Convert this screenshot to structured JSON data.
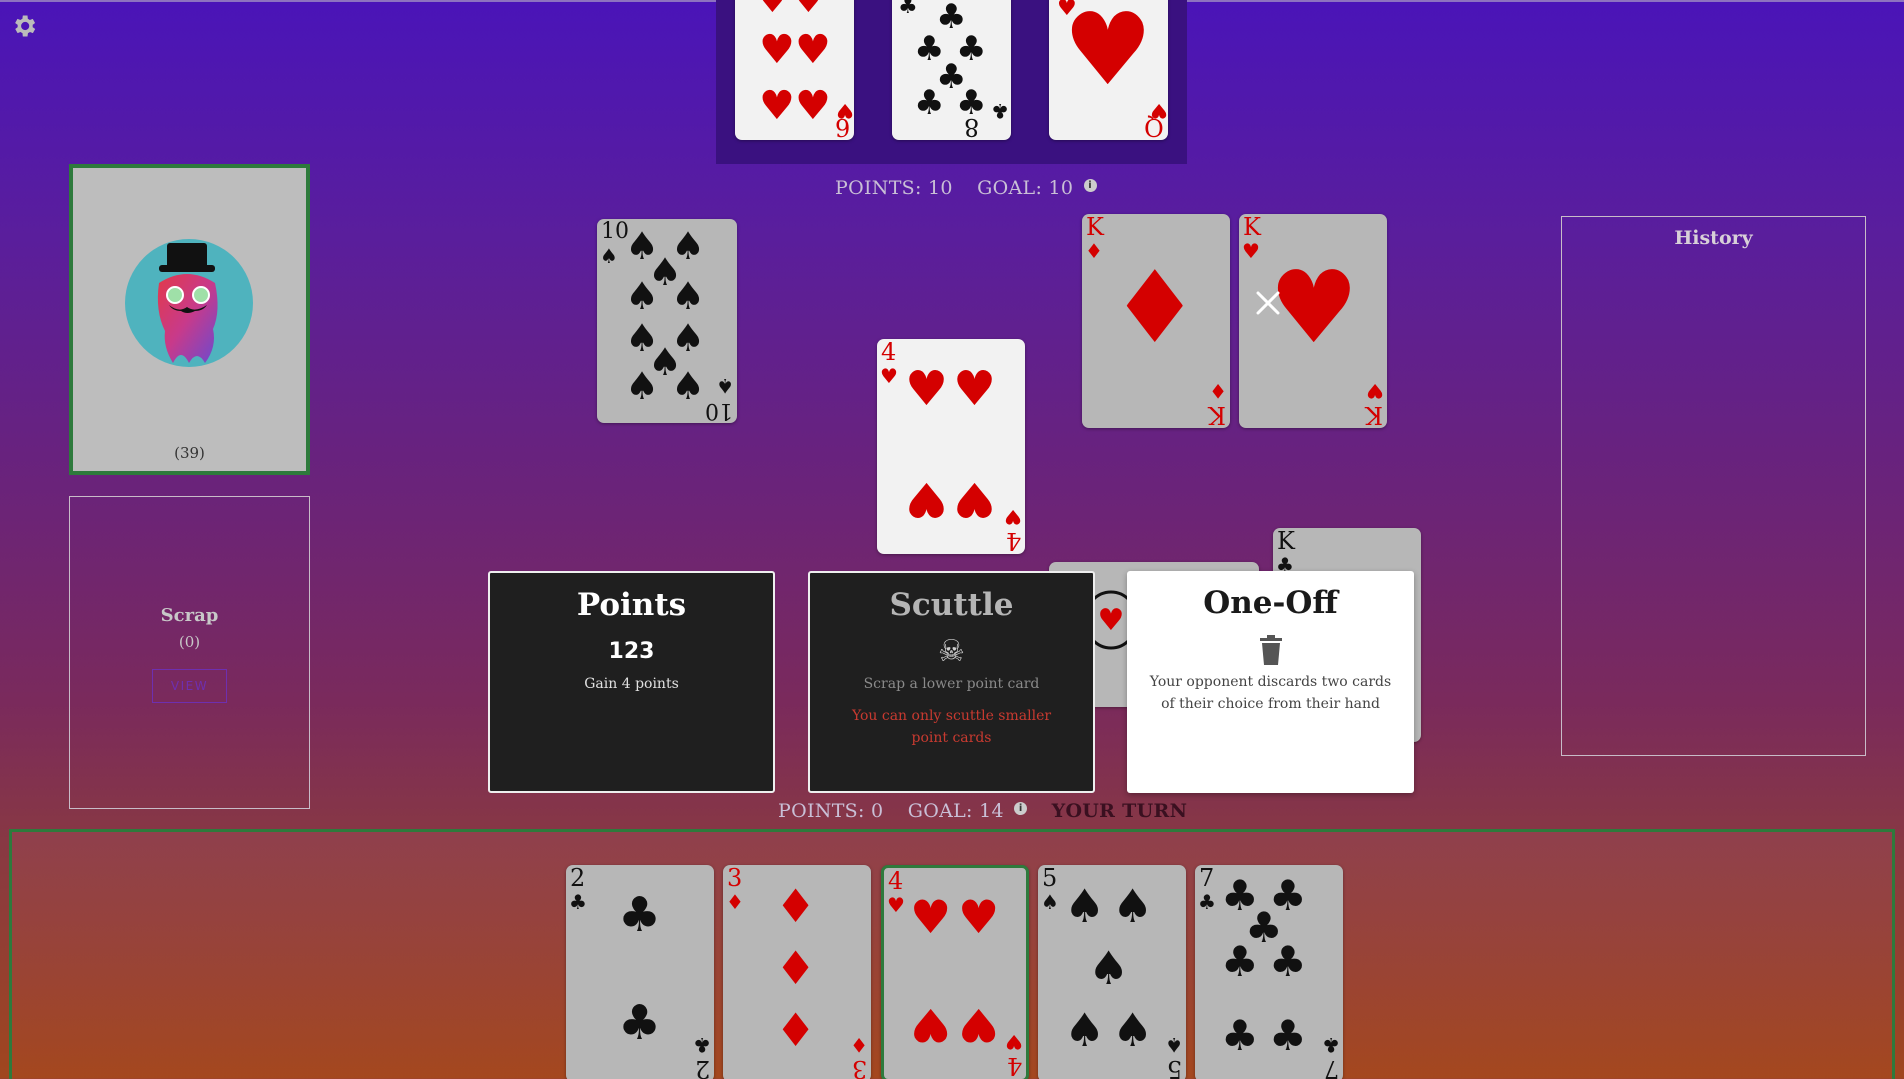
{
  "opponent": {
    "points_label": "POINTS: 10",
    "goal_label": "GOAL: 10",
    "hand": [
      {
        "rank": "6",
        "suit": "♥",
        "color": "red"
      },
      {
        "rank": "8",
        "suit": "♣",
        "color": "black"
      },
      {
        "rank": "Q",
        "suit": "♥",
        "color": "red"
      }
    ],
    "points_cards": [
      {
        "rank": "10",
        "suit": "♠",
        "color": "black"
      }
    ],
    "face_cards": [
      {
        "rank": "K",
        "suit": "♦",
        "color": "red"
      },
      {
        "rank": "K",
        "suit": "♥",
        "color": "red"
      }
    ]
  },
  "deck": {
    "count": "(39)"
  },
  "scrap": {
    "title": "Scrap",
    "count": "(0)",
    "view_label": "VIEW"
  },
  "history": {
    "title": "History"
  },
  "selected_card": {
    "rank": "4",
    "suit": "♥",
    "color": "red"
  },
  "moves": {
    "points": {
      "title": "Points",
      "icon": "123",
      "description": "Gain 4 points"
    },
    "scuttle": {
      "title": "Scuttle",
      "icon": "☠",
      "description": "Scrap a lower point card",
      "warning": "You can only scuttle smaller point cards"
    },
    "oneoff": {
      "title": "One-Off",
      "icon": "🗑",
      "description": "Your opponent discards two cards of their choice from their hand"
    }
  },
  "player": {
    "points_label": "POINTS: 0",
    "goal_label": "GOAL: 14",
    "turn_label": "YOUR TURN",
    "face_card_peek": {
      "rank": "K",
      "suit": "♣",
      "color": "black"
    },
    "hand": [
      {
        "rank": "2",
        "suit": "♣",
        "color": "black"
      },
      {
        "rank": "3",
        "suit": "♦",
        "color": "red"
      },
      {
        "rank": "4",
        "suit": "♥",
        "color": "red"
      },
      {
        "rank": "5",
        "suit": "♠",
        "color": "black"
      },
      {
        "rank": "7",
        "suit": "♣",
        "color": "black"
      }
    ]
  },
  "colors": {
    "accent_green": "#2e7a3c",
    "view_purple": "#6e2fb0",
    "warning_red": "#c83a30"
  }
}
